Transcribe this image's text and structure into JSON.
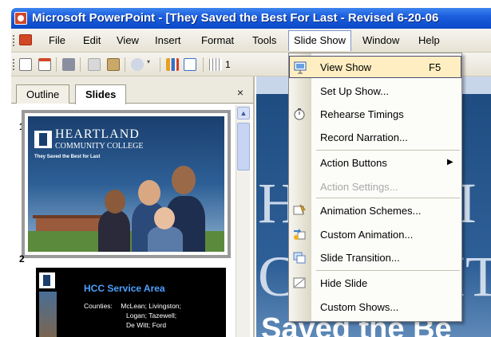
{
  "window": {
    "title": "Microsoft PowerPoint - [They Saved the Best For Last - Revised 6-20-06"
  },
  "menubar": {
    "items": [
      {
        "label": "File"
      },
      {
        "label": "Edit"
      },
      {
        "label": "View"
      },
      {
        "label": "Insert"
      },
      {
        "label": "Format"
      },
      {
        "label": "Tools"
      },
      {
        "label": "Slide Show",
        "active": true
      },
      {
        "label": "Window"
      },
      {
        "label": "Help"
      }
    ]
  },
  "toolbar": {
    "font_size_partial": "1"
  },
  "left_panel": {
    "tabs": [
      {
        "label": "Outline"
      },
      {
        "label": "Slides",
        "selected": true
      }
    ],
    "close_glyph": "×",
    "slides": [
      {
        "number": "1",
        "heading": "HEARTLAND",
        "subheading": "COMMUNITY COLLEGE",
        "tagline": "They Saved the Best for Last"
      },
      {
        "number": "2",
        "title": "HCC Service Area",
        "body_label": "Counties:",
        "body_lines": [
          "McLean; Livingston;",
          "Logan; Tazewell;",
          "De Witt; Ford"
        ]
      }
    ]
  },
  "main_slide": {
    "visible_letters": [
      "H",
      "C",
      "I",
      "IT"
    ],
    "bottom_text": "Saved the Be"
  },
  "slide_show_menu": {
    "items": [
      {
        "label": "View Show",
        "shortcut": "F5",
        "icon": "projector-screen-icon",
        "highlighted": true
      },
      {
        "label": "Set Up Show...",
        "icon": ""
      },
      {
        "label": "Rehearse Timings",
        "icon": "stopwatch-icon"
      },
      {
        "label": "Record Narration...",
        "icon": ""
      },
      {
        "label": "Action Buttons",
        "icon": "",
        "submenu": true
      },
      {
        "label": "Action Settings...",
        "icon": "",
        "disabled": true
      },
      {
        "label": "Animation Schemes...",
        "icon": "animation-schemes-icon"
      },
      {
        "label": "Custom Animation...",
        "icon": "custom-animation-icon"
      },
      {
        "label": "Slide Transition...",
        "icon": "slide-transition-icon"
      },
      {
        "label": "Hide Slide",
        "icon": "hide-slide-icon"
      },
      {
        "label": "Custom Shows...",
        "icon": ""
      }
    ]
  },
  "colors": {
    "titlebar": "#0a48c7",
    "menu_highlight": "#ffeec2",
    "slide_background": "#1f4d82"
  }
}
